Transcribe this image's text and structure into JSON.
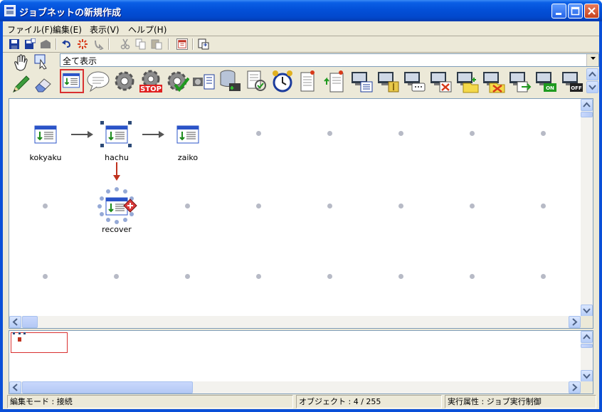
{
  "window": {
    "title": "ジョブネットの新規作成",
    "controls": [
      "minimize",
      "maximize",
      "close"
    ]
  },
  "menu": [
    {
      "label": "ファイル(F)"
    },
    {
      "label": "編集(E)"
    },
    {
      "label": "表示(V)"
    },
    {
      "label": "ヘルプ(H)"
    }
  ],
  "toolbar": [
    "save-icon",
    "save-as-icon",
    "open-icon",
    "undo-icon",
    "redo-icon",
    "reload-icon",
    "cut-icon",
    "copy-icon",
    "paste-icon",
    "grid-icon",
    "screen-icon"
  ],
  "palette": {
    "left_tools": [
      "hand-tool-icon",
      "zoom-tool-icon",
      "pencil-tool-icon",
      "eraser-tool-icon"
    ],
    "filter": {
      "value": "全て表示"
    },
    "items": [
      "job-icon",
      "comment-icon",
      "gear-icon",
      "gear-stop-icon",
      "gear-check-icon",
      "transfer-icon",
      "database-icon",
      "document-check-icon",
      "alarm-clock-icon",
      "document-pin-icon",
      "document-send-icon",
      "computer-list-icon",
      "computer-lock-icon",
      "computer-message-icon",
      "computer-delete-icon",
      "computer-folder-icon",
      "computer-cancel-icon",
      "computer-export-icon",
      "computer-on-icon",
      "computer-off-icon"
    ],
    "selected_index": 0,
    "on_label": "ON",
    "off_label": "OFF",
    "stop_label": "STOP"
  },
  "canvas": {
    "jobs": [
      {
        "name": "kokyaku"
      },
      {
        "name": "hachu"
      },
      {
        "name": "zaiko"
      },
      {
        "name": "recover"
      }
    ]
  },
  "status": {
    "mode": "編集モード : 接続",
    "objects": "オブジェクト : 4 / 255",
    "exec": "実行属性 : ジョブ実行制御"
  },
  "colors": {
    "titlebar": "#0350d8",
    "chrome": "#ece9d8",
    "selection_border": "#d93030",
    "arrow_normal": "#555555",
    "arrow_recovery": "#c0321e"
  }
}
